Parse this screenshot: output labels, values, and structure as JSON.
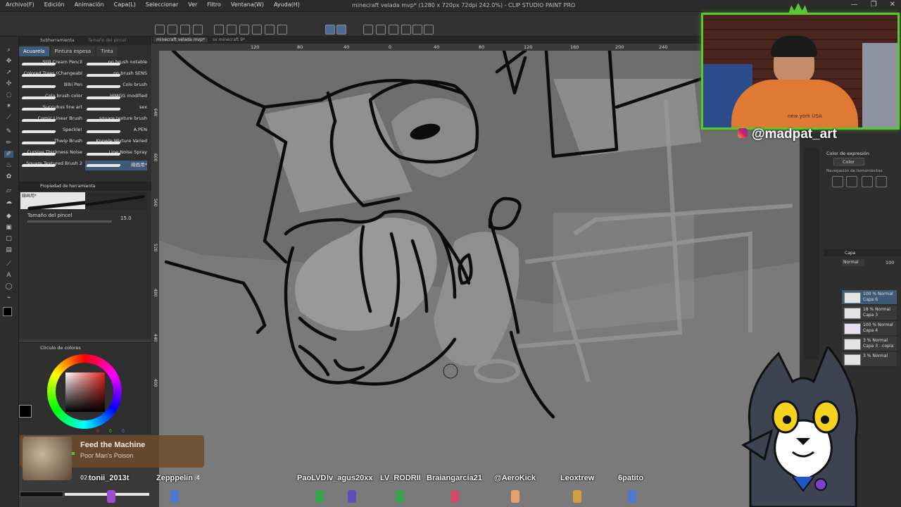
{
  "menubar": {
    "items": [
      "Archivo(F)",
      "Edición",
      "Animación",
      "Capa(L)",
      "Seleccionar",
      "Ver",
      "Filtro",
      "Ventana(W)",
      "Ayuda(H)"
    ],
    "window_title": "minecraft velada mvp* (1280 x 720px 72dpi 242.0%)  - CLIP STUDIO PAINT PRO",
    "window_buttons": [
      "—",
      "❐",
      "✕"
    ]
  },
  "document_tabs": [
    "minecraft velada mvp*",
    "sv minecraft 9*"
  ],
  "ruler": {
    "h_ticks": [
      "120",
      "80",
      "40",
      "0",
      "40",
      "80",
      "120",
      "160",
      "200",
      "240"
    ],
    "v_ticks": [
      "640",
      "600",
      "560",
      "520",
      "480",
      "440",
      "400"
    ]
  },
  "subtool_panel": {
    "header_tabs": [
      "Subherramienta",
      "Tamaño del pincel"
    ],
    "tabs": [
      {
        "label": "Acuarela",
        "active": true
      },
      {
        "label": "Pintura espesa",
        "active": false
      },
      {
        "label": "Tinta",
        "active": false
      }
    ],
    "brushes_left": [
      "Still Cream Pencil",
      "Colored Trees (Changeabl",
      "Bibi Pen",
      "Colo brush color",
      "Succubus line art",
      "Comic Linear Brush",
      "Speckle!",
      "Thwip Brush",
      "Cursive Thickness Noise",
      "Square Textured Brush 2"
    ],
    "brushes_right": [
      "nn brush notable",
      "nn brush SENS",
      "Colo brush",
      "HIMGG modified",
      "sex",
      "square texture brush",
      "A.PEN",
      "Knowle Mixture Varied",
      "Line Noise Spray",
      "線画用*"
    ]
  },
  "tool_property": {
    "title": "Propiedad de herramienta",
    "brush_name": "線画用*",
    "size_label": "Tamaño del pincel",
    "size_value": "15.0"
  },
  "color_panel": {
    "title": "Círculo de colores",
    "main_color": "#000000",
    "sub_color": "#ffffff",
    "values": [
      "0",
      "0",
      "0"
    ]
  },
  "webcam": {
    "shirt_text": "new york USA"
  },
  "handle": "@madpat_art",
  "right_panel": {
    "expression_label": "Color de expresión",
    "expression_value": "Color",
    "navigation_label": "Navegación de herramientas",
    "layer_panel_title": "Capa",
    "blend_mode": "Normal",
    "opacity": "100",
    "layers": [
      {
        "percent": "100 %",
        "name": "Capa 6",
        "blend": "Normal",
        "selected": true
      },
      {
        "percent": "18 %",
        "name": "Capa 3",
        "blend": "Normal",
        "selected": false
      },
      {
        "percent": "100 %",
        "name": "Capa 4",
        "blend": "Normal",
        "selected": false
      },
      {
        "percent": "3 %",
        "name": "Capa 3 - copia",
        "blend": "Normal",
        "selected": false
      },
      {
        "percent": "3 %",
        "name": "",
        "blend": "Normal",
        "selected": false
      }
    ]
  },
  "music": {
    "title": "Feed the Machine",
    "artist": "Poor Man's Poison",
    "time_start": "02:",
    "time_end": ":4"
  },
  "chat_names": [
    "tonii_2013t",
    "Zepppelin",
    "PaoLVD",
    "lv_agus20xx",
    "LV_RODRII",
    "Braiangarcia21",
    "@AeroKick",
    "Leoxtrew",
    "6patito"
  ],
  "colors": {
    "accent_green": "#5ac630",
    "active_tab": "#3f5a78",
    "canvas_bg": "#6e6e6e"
  }
}
